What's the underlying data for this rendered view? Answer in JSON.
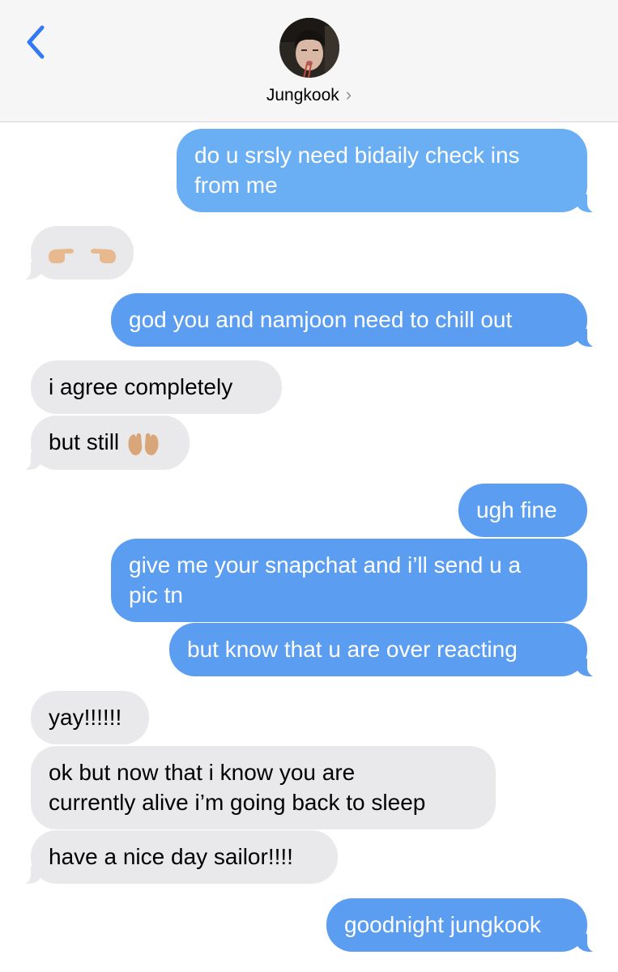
{
  "header": {
    "contact_name": "Jungkook",
    "chevron": "›"
  },
  "messages": [
    {
      "from": "me",
      "text_1": "do u srsly need bidaily check ins",
      "text_2": "from me"
    },
    {
      "from": "them",
      "emoji": "pointing-fingers-emoji"
    },
    {
      "from": "me",
      "text": "god you and namjoon need to chill out"
    },
    {
      "from": "them",
      "text": "i agree completely"
    },
    {
      "from": "them",
      "text": "but still",
      "emoji": "open-hands-emoji"
    },
    {
      "from": "me",
      "text": "ugh fine"
    },
    {
      "from": "me",
      "text_1": "give me your snapchat and i’ll send u a",
      "text_2": "pic tn"
    },
    {
      "from": "me",
      "text": "but know that u are over reacting"
    },
    {
      "from": "them",
      "text": "yay!!!!!!"
    },
    {
      "from": "them",
      "text_1": "ok but now that i know you are",
      "text_2": "currently alive i’m going back to sleep"
    },
    {
      "from": "them",
      "text": "have a nice day sailor!!!!"
    },
    {
      "from": "me",
      "text": "goodnight jungkook"
    }
  ],
  "colors": {
    "outgoing": "#5b9df1",
    "incoming": "#e9e9eb",
    "accent": "#3478f6"
  }
}
